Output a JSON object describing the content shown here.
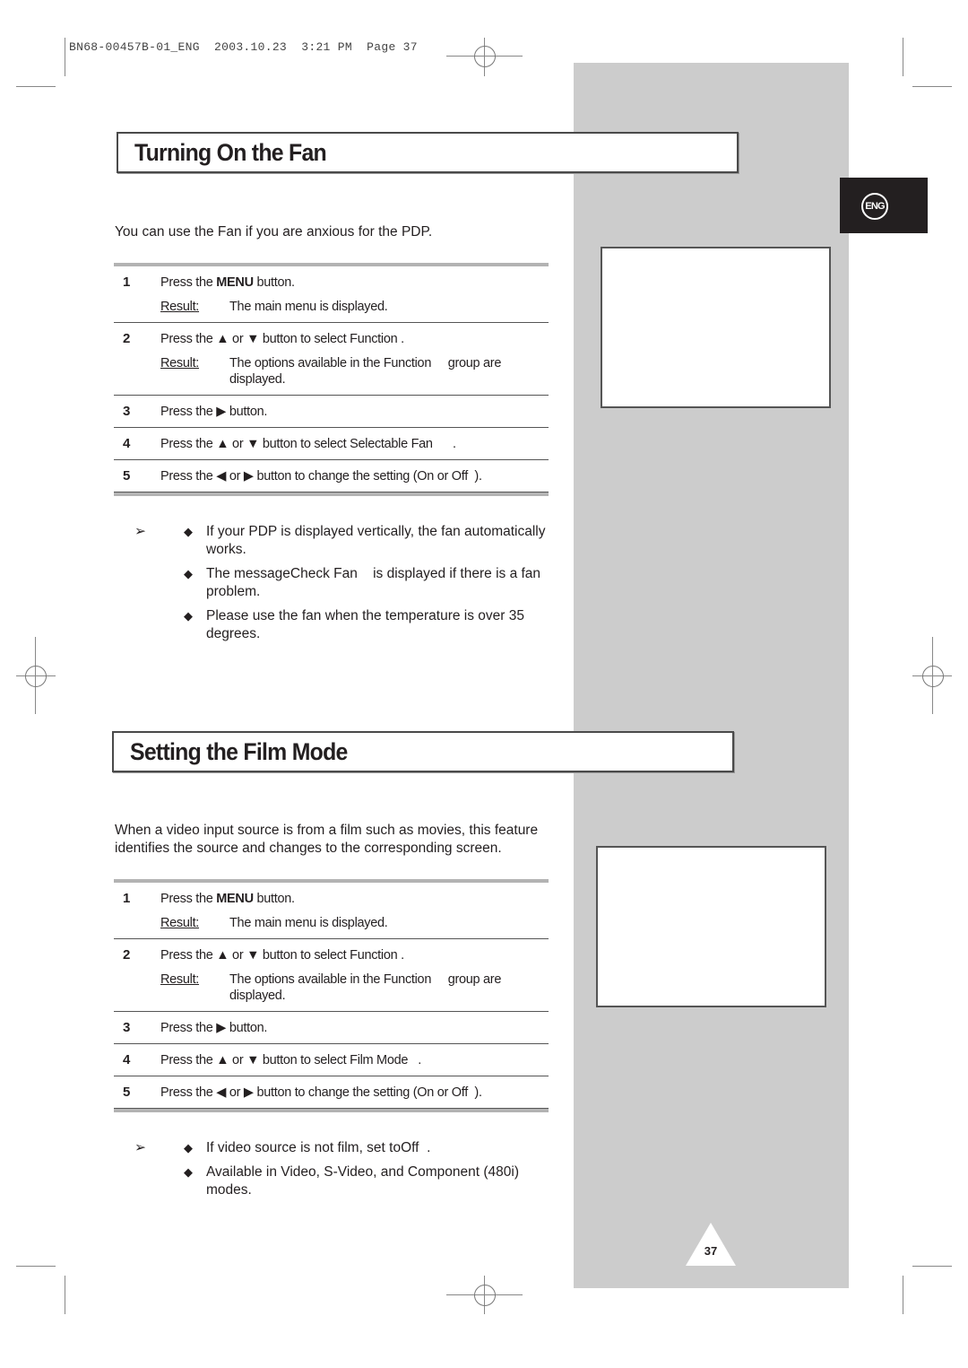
{
  "print_slug": "BN68-00457B-01_ENG  2003.10.23  3:21 PM  Page 37",
  "language_tab": {
    "label": "ENG",
    "icon": "eng-language-badge"
  },
  "page_number": "37",
  "sections": [
    {
      "title": "Turning On the Fan",
      "intro": "You can use the Fan if you are anxious for the PDP.",
      "steps": [
        {
          "num": "1",
          "pre": "Press the ",
          "bold": "MENU",
          "post": " button.",
          "result_label": "Result:",
          "result_text": "The main menu is displayed."
        },
        {
          "num": "2",
          "pre": "Press the ▲ or ▼ button to select Function",
          "post": " .",
          "result_label": "Result:",
          "result_text": "The options available in the Function     group are displayed."
        },
        {
          "num": "3",
          "pre": "Press the ▶ button."
        },
        {
          "num": "4",
          "pre": "Press the ▲ or ▼ button to select Selectable Fan",
          "post": "      ."
        },
        {
          "num": "5",
          "pre": "Press the ◀ or ▶ button to change the setting (On or Off  )."
        }
      ],
      "notes": [
        "If your PDP is displayed vertically, the fan automatically works.",
        "The messageCheck Fan    is displayed if there is a fan problem.",
        "Please use the fan when the temperature is over 35 degrees."
      ]
    },
    {
      "title": "Setting the Film Mode",
      "intro": "When a video input source is from a film such as movies, this feature identifies the source and changes to the corresponding screen.",
      "steps": [
        {
          "num": "1",
          "pre": "Press the ",
          "bold": "MENU",
          "post": " button.",
          "result_label": "Result:",
          "result_text": "The main menu is displayed."
        },
        {
          "num": "2",
          "pre": "Press the ▲ or ▼ button to select Function",
          "post": " .",
          "result_label": "Result:",
          "result_text": "The options available in the Function     group are displayed."
        },
        {
          "num": "3",
          "pre": "Press the ▶ button."
        },
        {
          "num": "4",
          "pre": "Press the ▲ or ▼ button to select Film Mode",
          "post": "   ."
        },
        {
          "num": "5",
          "pre": "Press the ◀ or ▶ button to change the setting (On or Off  )."
        }
      ],
      "notes": [
        "If video source is not film, set toOff  .",
        "Available in Video, S-Video, and Component (480i) modes."
      ]
    }
  ],
  "glyphs": {
    "note_arrow": "➢",
    "bullet": "◆"
  }
}
